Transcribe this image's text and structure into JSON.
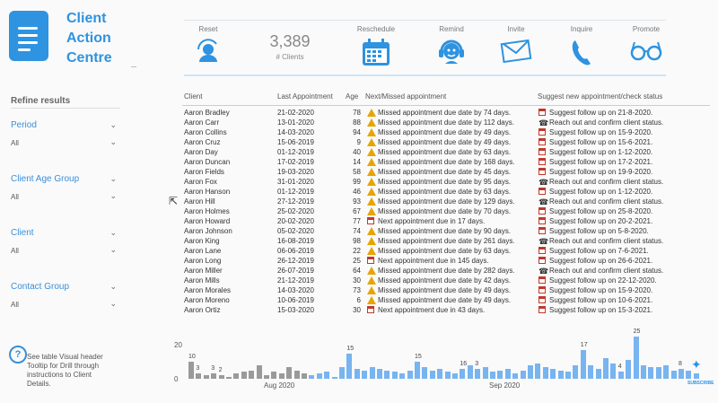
{
  "app": {
    "title_lines": [
      "Client",
      "Action",
      "Centre"
    ]
  },
  "toolbar": {
    "reset": "Reset",
    "kpi_value": "3,389",
    "kpi_label": "# Clients",
    "reschedule": "Reschedule",
    "remind": "Remind",
    "invite": "Invite",
    "inquire": "Inquire",
    "promote": "Promote"
  },
  "sidebar": {
    "heading": "Refine results",
    "slicers": [
      {
        "label": "Period",
        "value": "All"
      },
      {
        "label": "Client Age Group",
        "value": "All"
      },
      {
        "label": "Client",
        "value": "All"
      },
      {
        "label": "Contact Group",
        "value": "All"
      }
    ]
  },
  "table": {
    "headers": [
      "Client",
      "Last Appointment",
      "Age",
      "Next/Missed appointment",
      "Suggest new appointment/check status"
    ],
    "rows": [
      [
        "Aaron Bradley",
        "21-02-2020",
        "78",
        "warn",
        "Missed appointment due date by 74 days.",
        "cal",
        "Suggest follow up on 21-8-2020."
      ],
      [
        "Aaron Carr",
        "13-01-2020",
        "88",
        "warn",
        "Missed appointment due date by 112 days.",
        "phone",
        "Reach out and confirm client status."
      ],
      [
        "Aaron Collins",
        "14-03-2020",
        "94",
        "warn",
        "Missed appointment due date by 49 days.",
        "cal",
        "Suggest follow up on 15-9-2020."
      ],
      [
        "Aaron Cruz",
        "15-06-2019",
        "9",
        "warn",
        "Missed appointment due date by 49 days.",
        "cal",
        "Suggest follow up on 15-6-2021."
      ],
      [
        "Aaron Day",
        "01-12-2019",
        "40",
        "warn",
        "Missed appointment due date by 63 days.",
        "cal",
        "Suggest follow up on 1-12-2020."
      ],
      [
        "Aaron Duncan",
        "17-02-2019",
        "14",
        "warn",
        "Missed appointment due date by 168 days.",
        "cal",
        "Suggest follow up on 17-2-2021."
      ],
      [
        "Aaron Fields",
        "19-03-2020",
        "58",
        "warn",
        "Missed appointment due date by 45 days.",
        "cal",
        "Suggest follow up on 19-9-2020."
      ],
      [
        "Aaron Fox",
        "31-01-2020",
        "99",
        "warn",
        "Missed appointment due date by 95 days.",
        "phone",
        "Reach out and confirm client status."
      ],
      [
        "Aaron Hanson",
        "01-12-2019",
        "46",
        "warn",
        "Missed appointment due date by 63 days.",
        "cal",
        "Suggest follow up on 1-12-2020."
      ],
      [
        "Aaron Hill",
        "27-12-2019",
        "93",
        "warn",
        "Missed appointment due date by 129 days.",
        "phone",
        "Reach out and confirm client status."
      ],
      [
        "Aaron Holmes",
        "25-02-2020",
        "67",
        "warn",
        "Missed appointment due date by 70 days.",
        "cal",
        "Suggest follow up on 25-8-2020."
      ],
      [
        "Aaron Howard",
        "20-02-2020",
        "77",
        "cal",
        "Next appointment due in 17 days.",
        "cal",
        "Suggest follow up on 20-2-2021."
      ],
      [
        "Aaron Johnson",
        "05-02-2020",
        "74",
        "warn",
        "Missed appointment due date by 90 days.",
        "cal",
        "Suggest follow up on 5-8-2020."
      ],
      [
        "Aaron King",
        "16-08-2019",
        "98",
        "warn",
        "Missed appointment due date by 261 days.",
        "phone",
        "Reach out and confirm client status."
      ],
      [
        "Aaron Lane",
        "06-06-2019",
        "22",
        "warn",
        "Missed appointment due date by 63 days.",
        "cal",
        "Suggest follow up on 7-6-2021."
      ],
      [
        "Aaron Long",
        "26-12-2019",
        "25",
        "cal",
        "Next appointment due in 145 days.",
        "cal",
        "Suggest follow up on 26-6-2021."
      ],
      [
        "Aaron Miller",
        "26-07-2019",
        "64",
        "warn",
        "Missed appointment due date by 282 days.",
        "phone",
        "Reach out and confirm client status."
      ],
      [
        "Aaron Mills",
        "21-12-2019",
        "30",
        "warn",
        "Missed appointment due date by 42 days.",
        "cal",
        "Suggest follow up on 22-12-2020."
      ],
      [
        "Aaron Morales",
        "14-03-2020",
        "73",
        "warn",
        "Missed appointment due date by 49 days.",
        "cal",
        "Suggest follow up on 15-9-2020."
      ],
      [
        "Aaron Moreno",
        "10-06-2019",
        "6",
        "warn",
        "Missed appointment due date by 49 days.",
        "cal",
        "Suggest follow up on 10-6-2021."
      ],
      [
        "Aaron Ortiz",
        "15-03-2020",
        "30",
        "cal",
        "Next appointment due in 43 days.",
        "cal",
        "Suggest follow up on 15-3-2021."
      ]
    ]
  },
  "help": {
    "text": "See table Visual header Tooltip for Drill through instructions to Client Details."
  },
  "chart_data": {
    "type": "bar",
    "ylim": [
      0,
      20
    ],
    "ytick_labels": [
      "20",
      "0"
    ],
    "xtick_labels": [
      "Aug 2020",
      "Sep 2020"
    ],
    "values": [
      10,
      3,
      2,
      3,
      2,
      1,
      3,
      4,
      5,
      8,
      2,
      4,
      3,
      7,
      5,
      3,
      2,
      3,
      4,
      1,
      7,
      15,
      6,
      5,
      7,
      6,
      5,
      4,
      3,
      5,
      10,
      7,
      5,
      6,
      4,
      3,
      6,
      8,
      6,
      7,
      4,
      5,
      6,
      3,
      5,
      8,
      9,
      7,
      6,
      5,
      4,
      8,
      17,
      8,
      6,
      12,
      9,
      4,
      11,
      25,
      8,
      7,
      7,
      8,
      5,
      6,
      5,
      3
    ],
    "colors": {
      "past": "#9a9a9a",
      "future": "#78b4f0"
    },
    "past_count": 16,
    "data_labels": [
      [
        "10",
        0
      ],
      [
        "3",
        1
      ],
      [
        "3",
        3
      ],
      [
        "2",
        4
      ],
      [
        "15",
        21
      ],
      [
        "15",
        30
      ],
      [
        "16",
        36
      ],
      [
        "3",
        38
      ],
      [
        "17",
        52
      ],
      [
        "4",
        57
      ],
      [
        "25",
        59
      ],
      [
        "8",
        65
      ]
    ]
  },
  "branding": {
    "subscribe": "SUBSCRIBE"
  }
}
